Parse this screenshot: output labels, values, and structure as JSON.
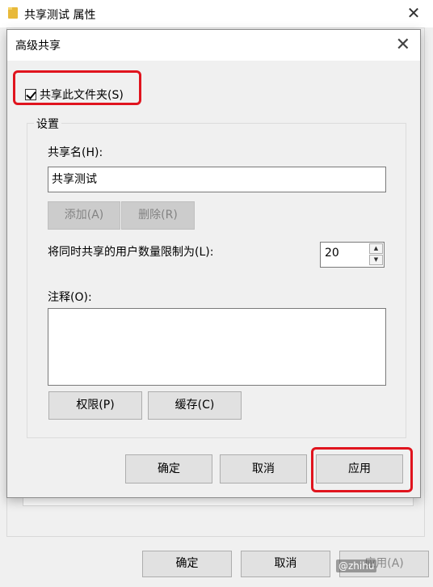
{
  "parent": {
    "title": "共享测试 属性",
    "close_glyph": "✕",
    "buttons": {
      "ok": "确定",
      "cancel": "取消",
      "apply": "应用(A)"
    }
  },
  "dialog": {
    "title": "高级共享",
    "close_glyph": "✕",
    "share_checkbox": {
      "label": "共享此文件夹(S)",
      "checked": true
    },
    "settings": {
      "legend": "设置",
      "share_name_label": "共享名(H):",
      "share_name_value": "共享测试",
      "add_button": "添加(A)",
      "remove_button": "删除(R)",
      "limit_label": "将同时共享的用户数量限制为(L):",
      "limit_value": "20",
      "comment_label": "注释(O):",
      "comment_value": "",
      "permissions_button": "权限(P)",
      "caching_button": "缓存(C)"
    },
    "buttons": {
      "ok": "确定",
      "cancel": "取消",
      "apply": "应用"
    }
  },
  "highlight_color": "#e0141e",
  "watermark": "@zhihu"
}
